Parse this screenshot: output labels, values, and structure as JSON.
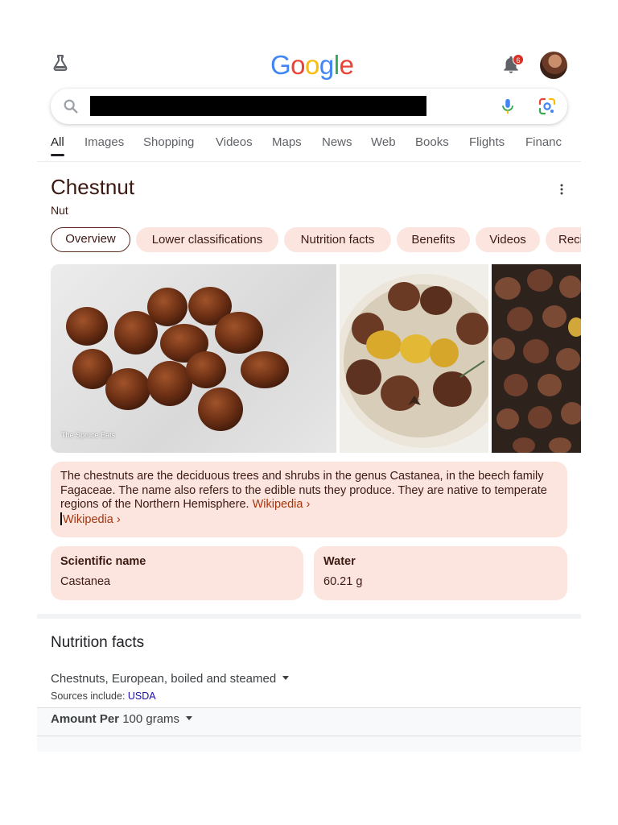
{
  "header": {
    "logo": "Google",
    "logo_colors": [
      "#4285F4",
      "#EA4335",
      "#FBBC05",
      "#4285F4",
      "#34A853",
      "#EA4335"
    ],
    "notification_count": "6",
    "labs_icon": "flask-icon",
    "notifications_icon": "bell-icon",
    "avatar": "user-avatar"
  },
  "search": {
    "query": "",
    "icons": [
      "search-icon",
      "mic-icon",
      "lens-icon"
    ]
  },
  "tabs": [
    {
      "label": "All",
      "active": true
    },
    {
      "label": "Images"
    },
    {
      "label": "Shopping"
    },
    {
      "label": "Videos"
    },
    {
      "label": "Maps"
    },
    {
      "label": "News"
    },
    {
      "label": "Web"
    },
    {
      "label": "Books"
    },
    {
      "label": "Flights"
    },
    {
      "label": "Financ"
    }
  ],
  "knowledge_panel": {
    "title": "Chestnut",
    "subtitle": "Nut",
    "chips": [
      {
        "label": "Overview",
        "active": true
      },
      {
        "label": "Lower classifications"
      },
      {
        "label": "Nutrition facts"
      },
      {
        "label": "Benefits"
      },
      {
        "label": "Videos"
      },
      {
        "label": "Reci"
      }
    ],
    "image_credit": "The Spruce Eats",
    "description": "The chestnuts are the deciduous trees and shrubs in the genus Castanea, in the beech family Fagaceae. The name also refers to the edible nuts they produce. They are native to temperate regions of the Northern Hemisphere.",
    "source_link": "Wikipedia",
    "source_link_2": "Wikipedia",
    "facts": [
      {
        "label": "Scientific name",
        "value": "Castanea"
      },
      {
        "label": "Water",
        "value": "60.21 g"
      }
    ],
    "colors": {
      "chip_bg": "#fce5de",
      "text": "#3c1a13",
      "link": "#a4360f"
    }
  },
  "nutrition": {
    "title": "Nutrition facts",
    "food_select": "Chestnuts, European, boiled and steamed",
    "sources_prefix": "Sources include:",
    "sources_link": "USDA",
    "amount_prefix": "Amount Per",
    "amount_select": "100 grams"
  }
}
